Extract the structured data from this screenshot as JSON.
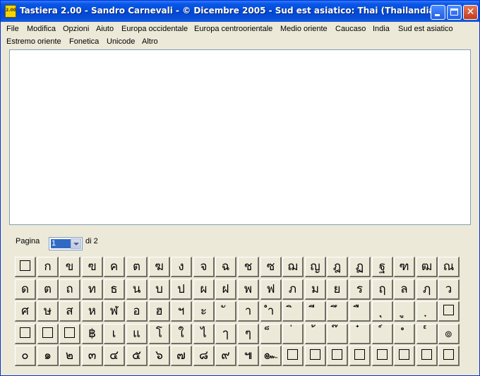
{
  "window": {
    "title": "Tastiera 2.00 - Sandro Carnevali - © Dicembre 2005 - Sud est asiatico: Thai (Thailandia)",
    "icon": "keyboard-app-icon",
    "icon_text": "2.00",
    "controls": {
      "minimize": "minimize-icon",
      "maximize": "maximize-icon",
      "close": "close-icon"
    }
  },
  "menu": {
    "row1": [
      "File",
      "Modifica",
      "Opzioni",
      "Aiuto",
      "Europa occidentale",
      "Europa centroorientale",
      "Medio oriente",
      "Caucaso",
      "India",
      "Sud est asiatico"
    ],
    "row2": [
      "Estremo oriente",
      "Fonetica",
      "Unicode",
      "Altro"
    ]
  },
  "editor": {
    "text": ""
  },
  "pager": {
    "label": "Pagina",
    "current": "1",
    "total_label": "di 2"
  },
  "keys": [
    [
      "□",
      "ก",
      "ข",
      "ฃ",
      "ค",
      "ต",
      "ฆ",
      "ง",
      "จ",
      "ฉ",
      "ช",
      "ซ",
      "ฌ",
      "ญ",
      "ฎ",
      "ฏ",
      "ฐ",
      "ฑ",
      "ฒ",
      "ณ"
    ],
    [
      "ด",
      "ต",
      "ถ",
      "ท",
      "ธ",
      "น",
      "บ",
      "ป",
      "ผ",
      "ฝ",
      "พ",
      "ฟ",
      "ภ",
      "ม",
      "ย",
      "ร",
      "ฤ",
      "ล",
      "ฦ",
      "ว"
    ],
    [
      "ศ",
      "ษ",
      "ส",
      "ห",
      "ฬ",
      "อ",
      "ฮ",
      "ฯ",
      "ะ",
      "ั",
      "า",
      "ำ",
      "ิ",
      "ี",
      "ึ",
      "ื",
      "ุ",
      "ู",
      "ฺ",
      "□"
    ],
    [
      "□",
      "□",
      "□",
      "฿",
      "เ",
      "แ",
      "โ",
      "ใ",
      "ไ",
      "ๅ",
      "ๆ",
      "็",
      "่",
      "้",
      "๊",
      "๋",
      "์",
      "ํ",
      "๎",
      "๏"
    ],
    [
      "๐",
      "๑",
      "๒",
      "๓",
      "๔",
      "๕",
      "๖",
      "๗",
      "๘",
      "๙",
      "๚",
      "๛",
      "□",
      "□",
      "□",
      "□",
      "□",
      "□",
      "□",
      "□"
    ]
  ]
}
